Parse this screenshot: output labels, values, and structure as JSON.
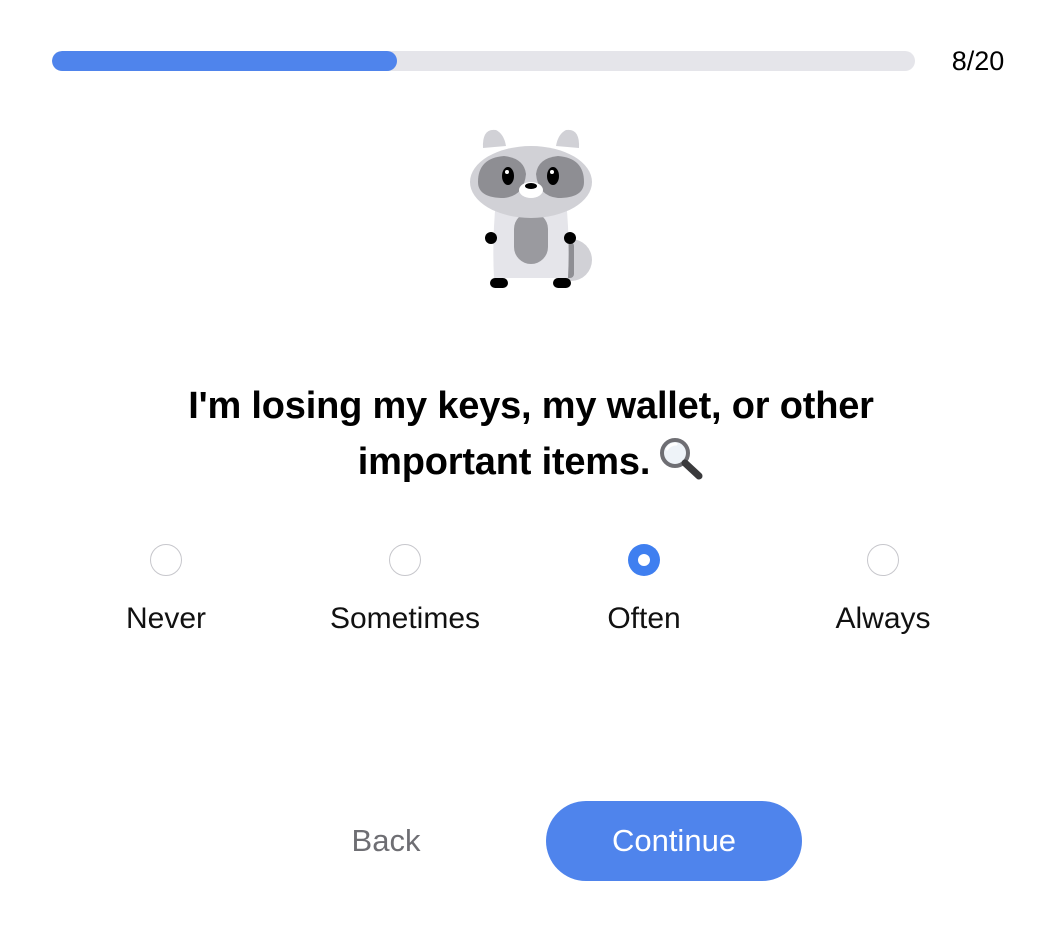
{
  "progress": {
    "current": 8,
    "total": 20,
    "label": "8/20",
    "fraction": 0.4
  },
  "mascot": {
    "icon": "raccoon-icon"
  },
  "question": {
    "text": "I'm losing my keys, my wallet, or other important items.",
    "emoji": "magnifying-glass-icon"
  },
  "options": [
    {
      "label": "Never",
      "selected": false
    },
    {
      "label": "Sometimes",
      "selected": false
    },
    {
      "label": "Often",
      "selected": true
    },
    {
      "label": "Always",
      "selected": false
    }
  ],
  "buttons": {
    "back_label": "Back",
    "continue_label": "Continue"
  },
  "colors": {
    "accent": "#4f84ec",
    "track": "#e5e5ea",
    "muted_text": "#6e6e73"
  }
}
